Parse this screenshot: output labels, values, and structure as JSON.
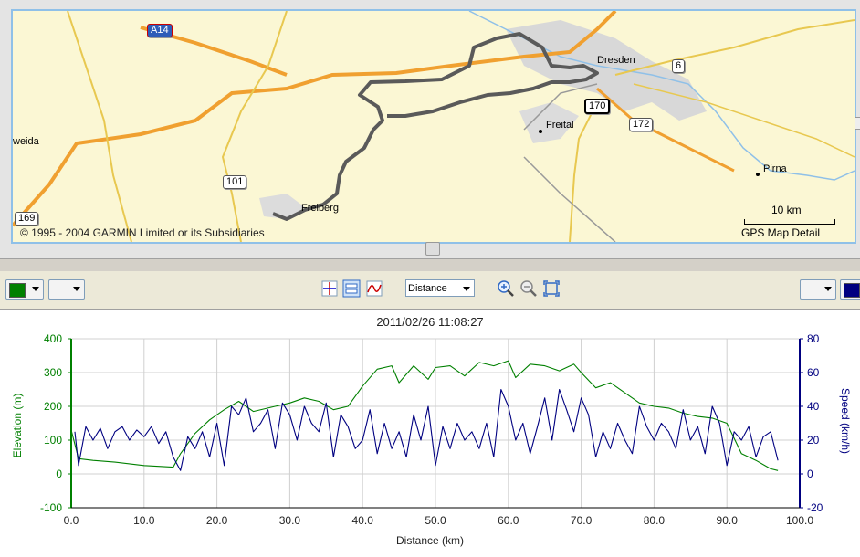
{
  "map": {
    "copyright": "© 1995 - 2004 GARMIN Limited or its Subsidiaries",
    "scale_label": "10 km",
    "map_detail": "GPS Map Detail",
    "shields": [
      {
        "label": "A14",
        "type": "autobahn"
      },
      {
        "label": "6",
        "type": "federal"
      },
      {
        "label": "170",
        "type": "federal-dark"
      },
      {
        "label": "172",
        "type": "federal"
      },
      {
        "label": "101",
        "type": "federal"
      },
      {
        "label": "169",
        "type": "federal"
      }
    ],
    "cities": {
      "dresden": "Dresden",
      "freital": "Freital",
      "pirna": "Pirna",
      "freiberg": "Freiberg",
      "weida": "weida"
    },
    "colors": {
      "background": "#fbf7d4",
      "track": "#5a5a5a",
      "motorway": "#f0a030",
      "road": "#e8c850",
      "water": "#8fc0e8",
      "urban": "#d8d8d8"
    }
  },
  "toolbar": {
    "left_color": "#008000",
    "right_color": "#000080",
    "view_select": "Distance",
    "icons": [
      "crosshair-icon",
      "split-view-icon",
      "graph-curve-icon",
      "zoom-in-icon",
      "zoom-out-icon",
      "fit-to-window-icon"
    ]
  },
  "chart_data": {
    "type": "line",
    "title": "2011/02/26 11:08:27",
    "xlabel": "Distance (km)",
    "ylabel_left": "Elevation (m)",
    "ylabel_right": "Speed (km/h)",
    "xlim": [
      0,
      100
    ],
    "ylim_left": [
      -100,
      400
    ],
    "ylim_right": [
      -20,
      80
    ],
    "grid": true,
    "x_ticks": [
      "0.0",
      "10.0",
      "20.0",
      "30.0",
      "40.0",
      "50.0",
      "60.0",
      "70.0",
      "80.0",
      "90.0",
      "100.0"
    ],
    "y_ticks_left": [
      "-100",
      "0",
      "100",
      "200",
      "300",
      "400"
    ],
    "y_ticks_right": [
      "-20",
      "0",
      "20",
      "40",
      "60",
      "80"
    ],
    "series": [
      {
        "axis": "left",
        "color": "#008000",
        "x": [
          0,
          1,
          3,
          6,
          10,
          14,
          15,
          17,
          19,
          21,
          23,
          25,
          28,
          30,
          32,
          34,
          36,
          38,
          40,
          42,
          44,
          45,
          47,
          49,
          50,
          52,
          54,
          56,
          58,
          60,
          61,
          63,
          65,
          67,
          69,
          70,
          72,
          74,
          76,
          78,
          80,
          82,
          84,
          86,
          88,
          90,
          92,
          94,
          96,
          97
        ],
        "y": [
          130,
          45,
          40,
          35,
          25,
          20,
          60,
          120,
          160,
          190,
          215,
          185,
          200,
          210,
          225,
          215,
          190,
          200,
          260,
          310,
          320,
          270,
          320,
          280,
          315,
          320,
          290,
          330,
          320,
          335,
          285,
          325,
          320,
          305,
          325,
          300,
          255,
          270,
          240,
          210,
          200,
          195,
          180,
          170,
          165,
          150,
          60,
          40,
          15,
          10
        ]
      },
      {
        "axis": "right",
        "color": "#000080",
        "x": [
          0.5,
          1,
          2,
          3,
          4,
          5,
          6,
          7,
          8,
          9,
          10,
          11,
          12,
          13,
          14,
          15,
          16,
          17,
          18,
          19,
          20,
          21,
          22,
          23,
          24,
          25,
          26,
          27,
          28,
          29,
          30,
          31,
          32,
          33,
          34,
          35,
          36,
          37,
          38,
          39,
          40,
          41,
          42,
          43,
          44,
          45,
          46,
          47,
          48,
          49,
          50,
          51,
          52,
          53,
          54,
          55,
          56,
          57,
          58,
          59,
          60,
          61,
          62,
          63,
          64,
          65,
          66,
          67,
          68,
          69,
          70,
          71,
          72,
          73,
          74,
          75,
          76,
          77,
          78,
          79,
          80,
          81,
          82,
          83,
          84,
          85,
          86,
          87,
          88,
          89,
          90,
          91,
          92,
          93,
          94,
          95,
          96,
          97
        ],
        "y": [
          25,
          5,
          28,
          20,
          27,
          15,
          25,
          28,
          20,
          26,
          22,
          28,
          18,
          25,
          10,
          2,
          22,
          15,
          25,
          10,
          30,
          5,
          40,
          35,
          45,
          25,
          30,
          38,
          15,
          42,
          35,
          20,
          40,
          30,
          25,
          42,
          10,
          35,
          28,
          15,
          20,
          38,
          12,
          30,
          15,
          25,
          10,
          35,
          20,
          40,
          5,
          28,
          15,
          30,
          20,
          25,
          15,
          30,
          10,
          50,
          40,
          20,
          30,
          12,
          28,
          45,
          20,
          50,
          38,
          25,
          45,
          35,
          10,
          25,
          15,
          30,
          20,
          12,
          40,
          28,
          20,
          30,
          25,
          15,
          38,
          20,
          28,
          12,
          40,
          30,
          5,
          25,
          20,
          28,
          10,
          22,
          25,
          8
        ]
      }
    ]
  }
}
